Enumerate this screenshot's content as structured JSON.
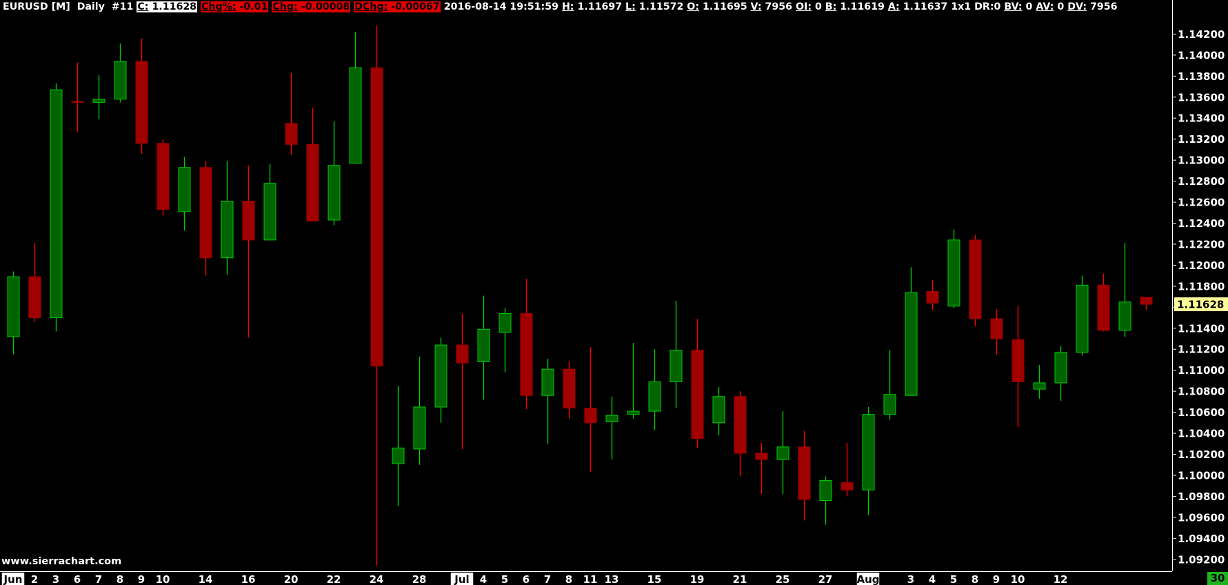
{
  "header": {
    "symbol": "EURUSD [M]",
    "timeframe": "Daily",
    "chart_number": "#11",
    "close_label": "C:",
    "close_value": "1.11628",
    "chg_pct_label": "Chg%:",
    "chg_pct_value": "-0.01",
    "chg_label": "Chg:",
    "chg_value": "-0.00008",
    "dchg_label": "DChg:",
    "dchg_value": "-0.00067",
    "datetime": "2016-08-14 19:51:59",
    "high_label": "H:",
    "high_value": "1.11697",
    "low_label": "L:",
    "low_value": "1.11572",
    "open_label": "O:",
    "open_value": "1.11695",
    "volume_label": "V:",
    "volume_value": "7956",
    "oi_label": "OI:",
    "oi_value": "0",
    "bid_label": "B:",
    "bid_value": "1.11619",
    "ask_label": "A:",
    "ask_value": "1.11637",
    "size_text": "1x1",
    "dr_text": "DR:0",
    "bv_label": "BV:",
    "bv_value": "0",
    "av_label": "AV:",
    "av_value": "0",
    "dv_label": "DV:",
    "dv_value": "7956"
  },
  "watermark": "www.sierrachart.com",
  "corner_value": "30",
  "colors": {
    "background": "#000000",
    "up": "#00cc00",
    "up_body": "#006400",
    "down_body": "#a00000",
    "down_wick": "#ff0000",
    "price_tag": "#ffff99"
  },
  "chart_data": {
    "type": "candlestick",
    "ylim": [
      1.091,
      1.1438
    ],
    "yticks": [
      "1.14200",
      "1.14000",
      "1.13800",
      "1.13600",
      "1.13400",
      "1.13200",
      "1.13000",
      "1.12800",
      "1.12600",
      "1.12400",
      "1.12200",
      "1.12000",
      "1.11800",
      "1.11600",
      "1.11400",
      "1.11200",
      "1.11000",
      "1.10800",
      "1.10600",
      "1.10400",
      "1.10200",
      "1.10000",
      "1.09800",
      "1.09600",
      "1.09400",
      "1.09200"
    ],
    "last_price": "1.11628",
    "x_labels": [
      "Jun",
      "2",
      "3",
      "6",
      "7",
      "8",
      "9",
      "10",
      "14",
      "16",
      "20",
      "22",
      "24",
      "28",
      "Jul",
      "4",
      "5",
      "6",
      "7",
      "8",
      "11",
      "13",
      "15",
      "19",
      "21",
      "25",
      "27",
      "Aug",
      "3",
      "4",
      "5",
      "8",
      "9",
      "10",
      "12"
    ],
    "month_labels": [
      "Jun",
      "Jul",
      "Aug"
    ],
    "candles": [
      {
        "o": 1.1132,
        "h": 1.1194,
        "l": 1.1115,
        "c": 1.1189
      },
      {
        "o": 1.1189,
        "h": 1.1221,
        "l": 1.1146,
        "c": 1.115
      },
      {
        "o": 1.115,
        "h": 1.1373,
        "l": 1.1137,
        "c": 1.1367
      },
      {
        "o": 1.1356,
        "h": 1.1393,
        "l": 1.1327,
        "c": 1.1355
      },
      {
        "o": 1.1355,
        "h": 1.1381,
        "l": 1.1339,
        "c": 1.1358
      },
      {
        "o": 1.1358,
        "h": 1.1411,
        "l": 1.1355,
        "c": 1.1394
      },
      {
        "o": 1.1394,
        "h": 1.1416,
        "l": 1.1306,
        "c": 1.1316
      },
      {
        "o": 1.1316,
        "h": 1.132,
        "l": 1.1247,
        "c": 1.1253
      },
      {
        "o": 1.1251,
        "h": 1.1303,
        "l": 1.1233,
        "c": 1.1293
      },
      {
        "o": 1.1293,
        "h": 1.1299,
        "l": 1.119,
        "c": 1.1207
      },
      {
        "o": 1.1207,
        "h": 1.1299,
        "l": 1.1191,
        "c": 1.1261
      },
      {
        "o": 1.1261,
        "h": 1.1295,
        "l": 1.1131,
        "c": 1.1224
      },
      {
        "o": 1.1224,
        "h": 1.1296,
        "l": 1.1224,
        "c": 1.1278
      },
      {
        "o": 1.1335,
        "h": 1.1383,
        "l": 1.1305,
        "c": 1.1315
      },
      {
        "o": 1.1315,
        "h": 1.135,
        "l": 1.1242,
        "c": 1.1242
      },
      {
        "o": 1.1243,
        "h": 1.1337,
        "l": 1.1238,
        "c": 1.1295
      },
      {
        "o": 1.1297,
        "h": 1.1422,
        "l": 1.1297,
        "c": 1.1388
      },
      {
        "o": 1.1388,
        "h": 1.1428,
        "l": 1.0914,
        "c": 1.1104
      },
      {
        "o": 1.1011,
        "h": 1.1085,
        "l": 1.0971,
        "c": 1.1026
      },
      {
        "o": 1.1025,
        "h": 1.1113,
        "l": 1.101,
        "c": 1.1065
      },
      {
        "o": 1.1065,
        "h": 1.1131,
        "l": 1.105,
        "c": 1.1124
      },
      {
        "o": 1.1124,
        "h": 1.1154,
        "l": 1.1025,
        "c": 1.1107
      },
      {
        "o": 1.1108,
        "h": 1.1171,
        "l": 1.1072,
        "c": 1.1139
      },
      {
        "o": 1.1136,
        "h": 1.1159,
        "l": 1.1098,
        "c": 1.1154
      },
      {
        "o": 1.1154,
        "h": 1.1187,
        "l": 1.1063,
        "c": 1.1076
      },
      {
        "o": 1.1076,
        "h": 1.1111,
        "l": 1.103,
        "c": 1.1101
      },
      {
        "o": 1.1101,
        "h": 1.1108,
        "l": 1.1054,
        "c": 1.1064
      },
      {
        "o": 1.1064,
        "h": 1.1122,
        "l": 1.1003,
        "c": 1.105
      },
      {
        "o": 1.1051,
        "h": 1.1075,
        "l": 1.1015,
        "c": 1.1057
      },
      {
        "o": 1.1058,
        "h": 1.1126,
        "l": 1.1054,
        "c": 1.1061
      },
      {
        "o": 1.1061,
        "h": 1.112,
        "l": 1.1043,
        "c": 1.1089
      },
      {
        "o": 1.1089,
        "h": 1.1166,
        "l": 1.1064,
        "c": 1.1119
      },
      {
        "o": 1.1119,
        "h": 1.1149,
        "l": 1.1026,
        "c": 1.1035
      },
      {
        "o": 1.105,
        "h": 1.1084,
        "l": 1.1038,
        "c": 1.1075
      },
      {
        "o": 1.1075,
        "h": 1.108,
        "l": 1.0999,
        "c": 1.1021
      },
      {
        "o": 1.1021,
        "h": 1.1031,
        "l": 1.0982,
        "c": 1.1015
      },
      {
        "o": 1.1015,
        "h": 1.1061,
        "l": 1.0982,
        "c": 1.1027
      },
      {
        "o": 1.1027,
        "h": 1.1042,
        "l": 1.0957,
        "c": 1.0977
      },
      {
        "o": 1.0976,
        "h": 1.0999,
        "l": 1.0953,
        "c": 1.0995
      },
      {
        "o": 1.0993,
        "h": 1.1031,
        "l": 1.098,
        "c": 1.0986
      },
      {
        "o": 1.0986,
        "h": 1.1065,
        "l": 1.0962,
        "c": 1.1058
      },
      {
        "o": 1.1058,
        "h": 1.1119,
        "l": 1.1053,
        "c": 1.1077
      },
      {
        "o": 1.1076,
        "h": 1.1198,
        "l": 1.1076,
        "c": 1.1174
      },
      {
        "o": 1.1175,
        "h": 1.1186,
        "l": 1.1157,
        "c": 1.1164
      },
      {
        "o": 1.1161,
        "h": 1.1234,
        "l": 1.1159,
        "c": 1.1224
      },
      {
        "o": 1.1224,
        "h": 1.1229,
        "l": 1.1142,
        "c": 1.1149
      },
      {
        "o": 1.1149,
        "h": 1.1158,
        "l": 1.1115,
        "c": 1.113
      },
      {
        "o": 1.1129,
        "h": 1.1161,
        "l": 1.1046,
        "c": 1.1089
      },
      {
        "o": 1.1082,
        "h": 1.1105,
        "l": 1.1073,
        "c": 1.1088
      },
      {
        "o": 1.1088,
        "h": 1.1123,
        "l": 1.1071,
        "c": 1.1117
      },
      {
        "o": 1.1117,
        "h": 1.119,
        "l": 1.1114,
        "c": 1.1181
      },
      {
        "o": 1.1181,
        "h": 1.1192,
        "l": 1.1137,
        "c": 1.1138
      },
      {
        "o": 1.1138,
        "h": 1.1221,
        "l": 1.1132,
        "c": 1.1165
      },
      {
        "o": 1.11695,
        "h": 1.11697,
        "l": 1.11572,
        "c": 1.11628
      }
    ]
  }
}
